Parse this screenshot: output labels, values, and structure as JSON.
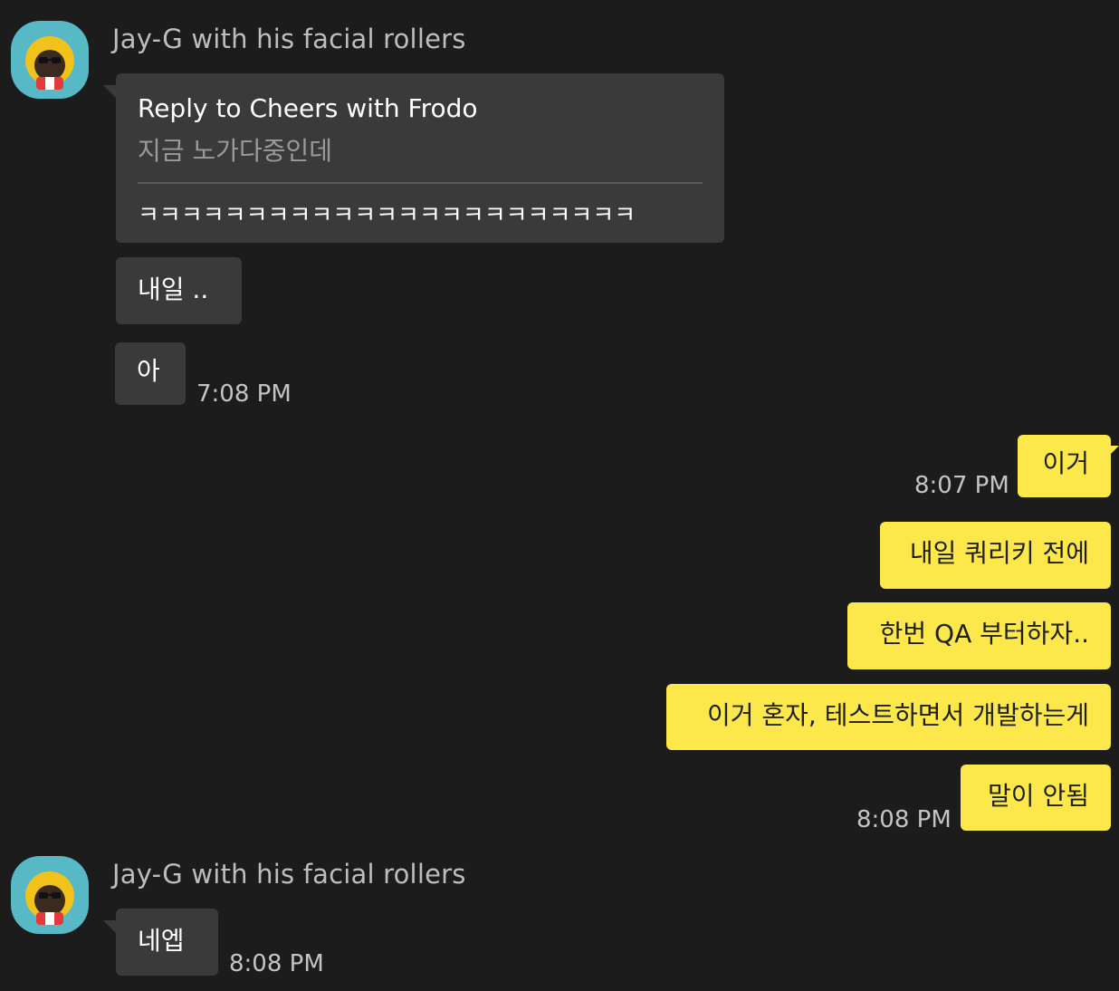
{
  "app": {
    "colors": {
      "background": "#1c1c1c",
      "incoming_bubble": "#3a3a3a",
      "outgoing_bubble": "#fce84a",
      "avatar_bg": "#57b8c6"
    }
  },
  "groups": [
    {
      "sender": "Jay-G with his facial rollers",
      "avatar_icon": "character-avatar-icon",
      "reply": {
        "title": "Reply to Cheers with Frodo",
        "quoted": "지금 노가다중인데",
        "text": "ㅋㅋㅋㅋㅋㅋㅋㅋㅋㅋㅋㅋㅋㅋㅋㅋㅋㅋㅋㅋㅋㅋㅋ"
      },
      "messages": [
        {
          "text": "내일 .."
        },
        {
          "text": "아",
          "time": "7:08 PM"
        }
      ]
    },
    {
      "outgoing": true,
      "messages": [
        {
          "text": "이거",
          "time": "8:07 PM"
        },
        {
          "text": "내일 쿼리키 전에"
        },
        {
          "text": "한번 QA 부터하자.."
        },
        {
          "text": "이거 혼자, 테스트하면서 개발하는게"
        },
        {
          "text": "말이 안됨",
          "time": "8:08 PM"
        }
      ]
    },
    {
      "sender": "Jay-G with his facial rollers",
      "avatar_icon": "character-avatar-icon",
      "messages": [
        {
          "text": "네엡",
          "time": "8:08 PM"
        }
      ]
    }
  ]
}
